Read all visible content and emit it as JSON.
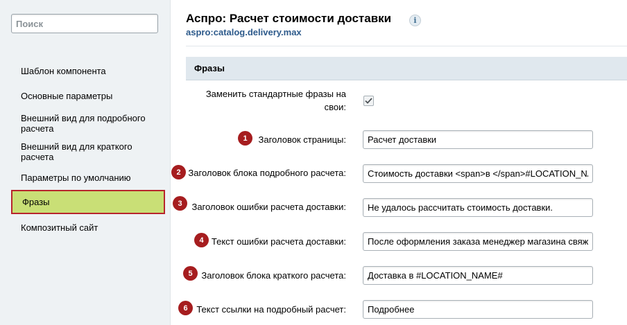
{
  "sidebar": {
    "search_placeholder": "Поиск",
    "items": [
      {
        "label": "Шаблон компонента"
      },
      {
        "label": "Основные параметры"
      },
      {
        "label": "Внешний вид для подробного расчета"
      },
      {
        "label": "Внешний вид для краткого расчета"
      },
      {
        "label": "Параметры по умолчанию"
      },
      {
        "label": "Фразы",
        "active": true
      },
      {
        "label": "Композитный сайт"
      }
    ]
  },
  "header": {
    "title": "Аспро: Расчет стоимости доставки",
    "subtitle": "aspro:catalog.delivery.max",
    "info_icon": "i"
  },
  "section": {
    "title": "Фразы"
  },
  "form": {
    "replace_label": "Заменить стандартные фразы на свои:",
    "replace_checked": true,
    "rows": [
      {
        "badge": "1",
        "label": "Заголовок страницы:",
        "value": "Расчет доставки"
      },
      {
        "badge": "2",
        "label": "Заголовок блока подробного расчета:",
        "value": "Стоимость доставки <span>в </span>#LOCATION_NAME#"
      },
      {
        "badge": "3",
        "label": "Заголовок ошибки расчета доставки:",
        "value": "Не удалось рассчитать стоимость доставки."
      },
      {
        "badge": "4",
        "label": "Текст ошибки расчета доставки:",
        "value": "После оформления заказа менеджер магазина свяжется с вами"
      },
      {
        "badge": "5",
        "label": "Заголовок блока краткого расчета:",
        "value": "Доставка в #LOCATION_NAME#"
      },
      {
        "badge": "6",
        "label": "Текст ссылки на подробный расчет:",
        "value": "Подробнее"
      }
    ]
  },
  "colors": {
    "accent_active": "#c9df76",
    "active_border": "#b8252c",
    "badge": "#a61d1f",
    "link": "#2d5a8b"
  }
}
